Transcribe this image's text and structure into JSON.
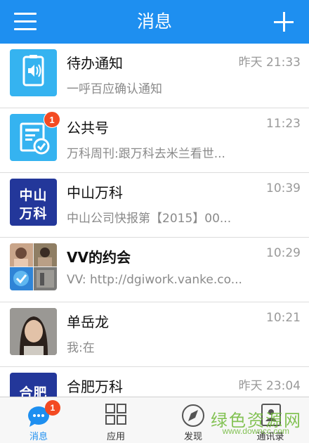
{
  "header": {
    "title": "消息"
  },
  "chats": [
    {
      "name": "待办通知",
      "time": "昨天 21:33",
      "preview": "一呼百应确认通知",
      "badge": ""
    },
    {
      "name": "公共号",
      "time": "11:23",
      "preview": "万科周刊:跟万科去米兰看世...",
      "badge": "1"
    },
    {
      "name": "中山万科",
      "time": "10:39",
      "preview": "中山公司快报第【2015】00...",
      "badge": "",
      "logo_text": [
        "中山",
        "万科"
      ]
    },
    {
      "name": "VV的约会",
      "time": "10:29",
      "preview": "VV: http://dgiwork.vanke.co...",
      "badge": ""
    },
    {
      "name": "单岳龙",
      "time": "10:21",
      "preview": "我:在",
      "badge": ""
    },
    {
      "name": "合肥万科",
      "time": "昨天 23:04",
      "preview": "",
      "badge": "",
      "logo_text": [
        "合肥"
      ]
    }
  ],
  "tabs": [
    {
      "label": "消息",
      "badge": "1",
      "active": true
    },
    {
      "label": "应用"
    },
    {
      "label": "发现"
    },
    {
      "label": "通讯录"
    }
  ],
  "watermark": {
    "line1": "绿色资源网",
    "line2": "www.downcc.com"
  },
  "colors": {
    "header": "#1e8ff0",
    "tile_blue": "#35b3f0",
    "tile_navy": "#23379a",
    "badge": "#f34a22",
    "active_tab": "#1e8ff0"
  }
}
